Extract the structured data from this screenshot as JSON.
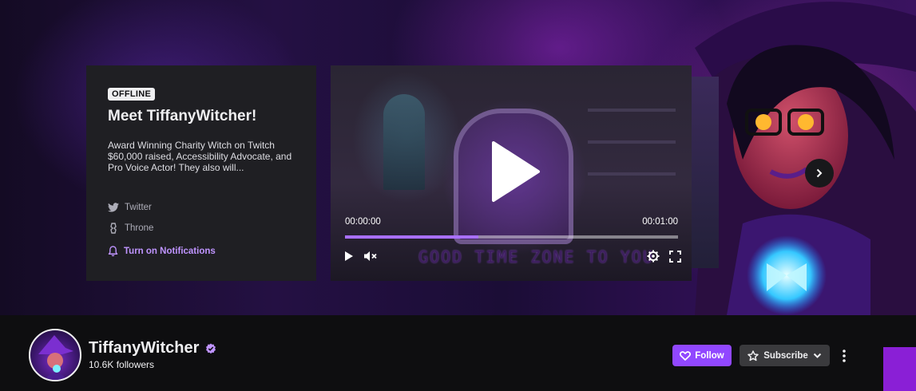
{
  "info_card": {
    "badge": "OFFLINE",
    "title": "Meet TiffanyWitcher!",
    "description": "Award Winning Charity Witch on Twitch $60,000 raised, Accessibility Advocate, and Pro Voice Actor! They also will...",
    "socials": [
      {
        "label": "Twitter",
        "icon": "twitter-icon"
      },
      {
        "label": "Throne",
        "icon": "throne-icon"
      }
    ],
    "notifications_label": "Turn on Notifications"
  },
  "player": {
    "current_time": "00:00:00",
    "duration": "00:01:00",
    "progress_percent": 40,
    "caption": "GOOD TIME ZONE TO YOU",
    "muted": true
  },
  "channel": {
    "name": "TiffanyWitcher",
    "followers": "10.6K followers",
    "verified": true,
    "follow_label": "Follow",
    "subscribe_label": "Subscribe"
  },
  "colors": {
    "accent": "#9147ff",
    "link": "#bf94ff",
    "background": "#0e0e10"
  }
}
